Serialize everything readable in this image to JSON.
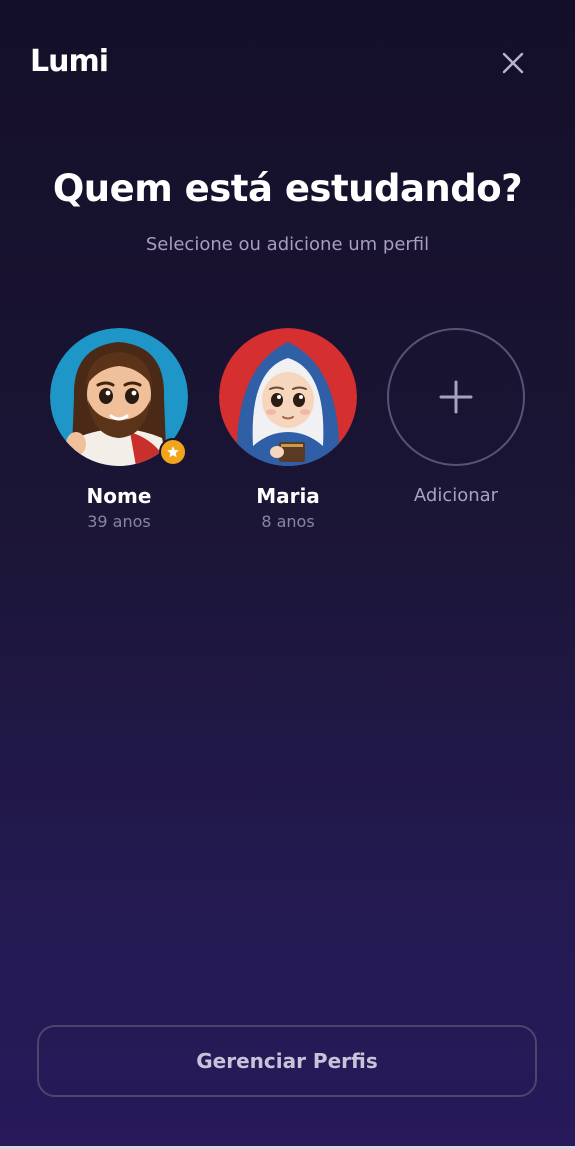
{
  "app": {
    "brand": "Lumi",
    "close_icon": "close-icon"
  },
  "header": {
    "title": "Quem está estudando?",
    "subtitle": "Selecione ou adicione um perfil"
  },
  "profiles": [
    {
      "name": "Nome",
      "age": "39 anos",
      "avatar": "jesus-avatar",
      "badge": "star-icon",
      "ring_color": "#1f96c8"
    },
    {
      "name": "Maria",
      "age": "8 anos",
      "avatar": "mary-avatar",
      "ring_color": "#d62f2f"
    }
  ],
  "add_profile": {
    "label": "Adicionar",
    "icon": "plus-icon"
  },
  "footer": {
    "manage_label": "Gerenciar Perfis"
  },
  "colors": {
    "background_top": "#140f28",
    "background_bottom": "#27195a",
    "badge": "#f1a51b",
    "muted_text": "#a69fbd"
  }
}
